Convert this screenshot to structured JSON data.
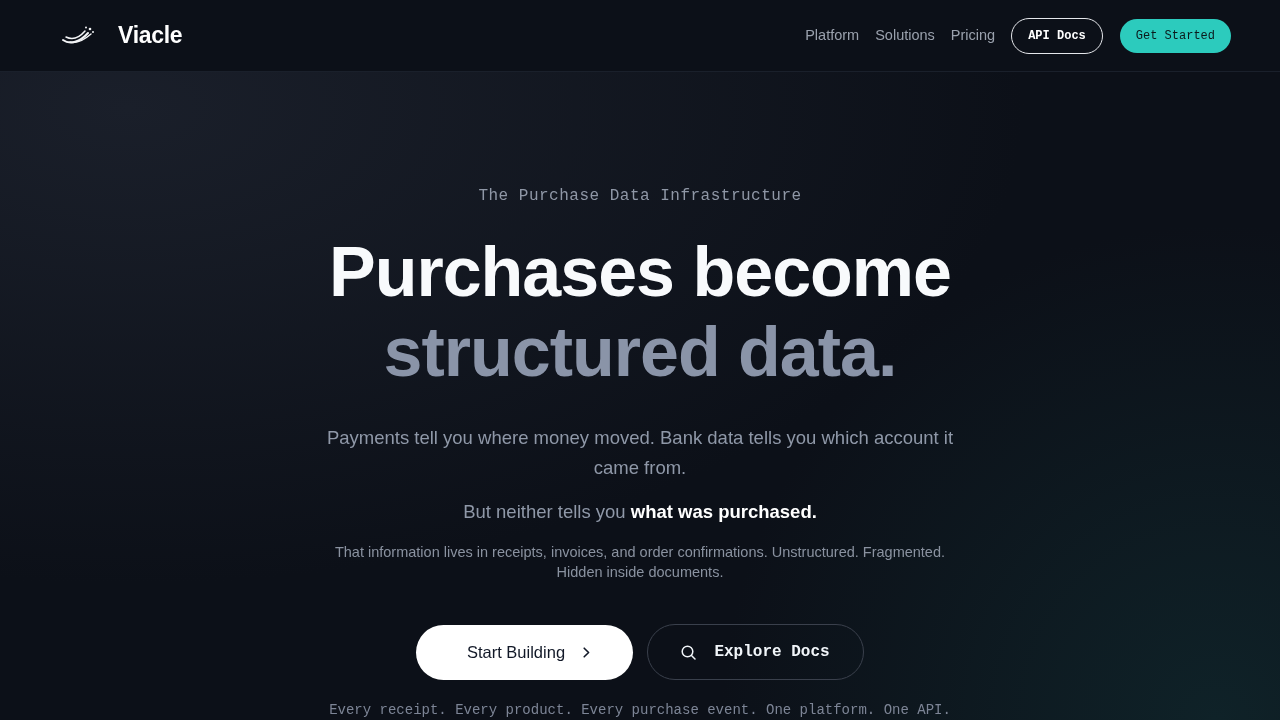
{
  "brand": {
    "name": "Viacle"
  },
  "nav": {
    "links": [
      {
        "label": "Platform"
      },
      {
        "label": "Solutions"
      },
      {
        "label": "Pricing"
      }
    ],
    "buttons": [
      {
        "label": "API Docs",
        "kind": "outline"
      },
      {
        "label": "Get Started",
        "kind": "primary"
      }
    ]
  },
  "hero": {
    "eyebrow": "The Purchase Data Infrastructure",
    "headline": [
      {
        "text": "Purchases become",
        "kind": "strong"
      },
      {
        "text": "structured data.",
        "kind": "muted"
      }
    ],
    "paragraphs": [
      {
        "text": "Payments tell you where money moved. Bank data tells you which account it came from.",
        "kind": "lead"
      },
      {
        "text": "But neither tells you **what was purchased.**",
        "kind": "lead"
      },
      {
        "text": "That information lives in receipts, invoices, and order confirmations. Unstructured. Fragmented. Hidden inside documents.",
        "kind": "small"
      }
    ],
    "actions": [
      {
        "label": "Start Building",
        "kind": "primary"
      },
      {
        "label": "Explore Docs",
        "kind": "secondary"
      }
    ],
    "tagline": "Every receipt. Every product. Every purchase event. One platform. One API."
  }
}
